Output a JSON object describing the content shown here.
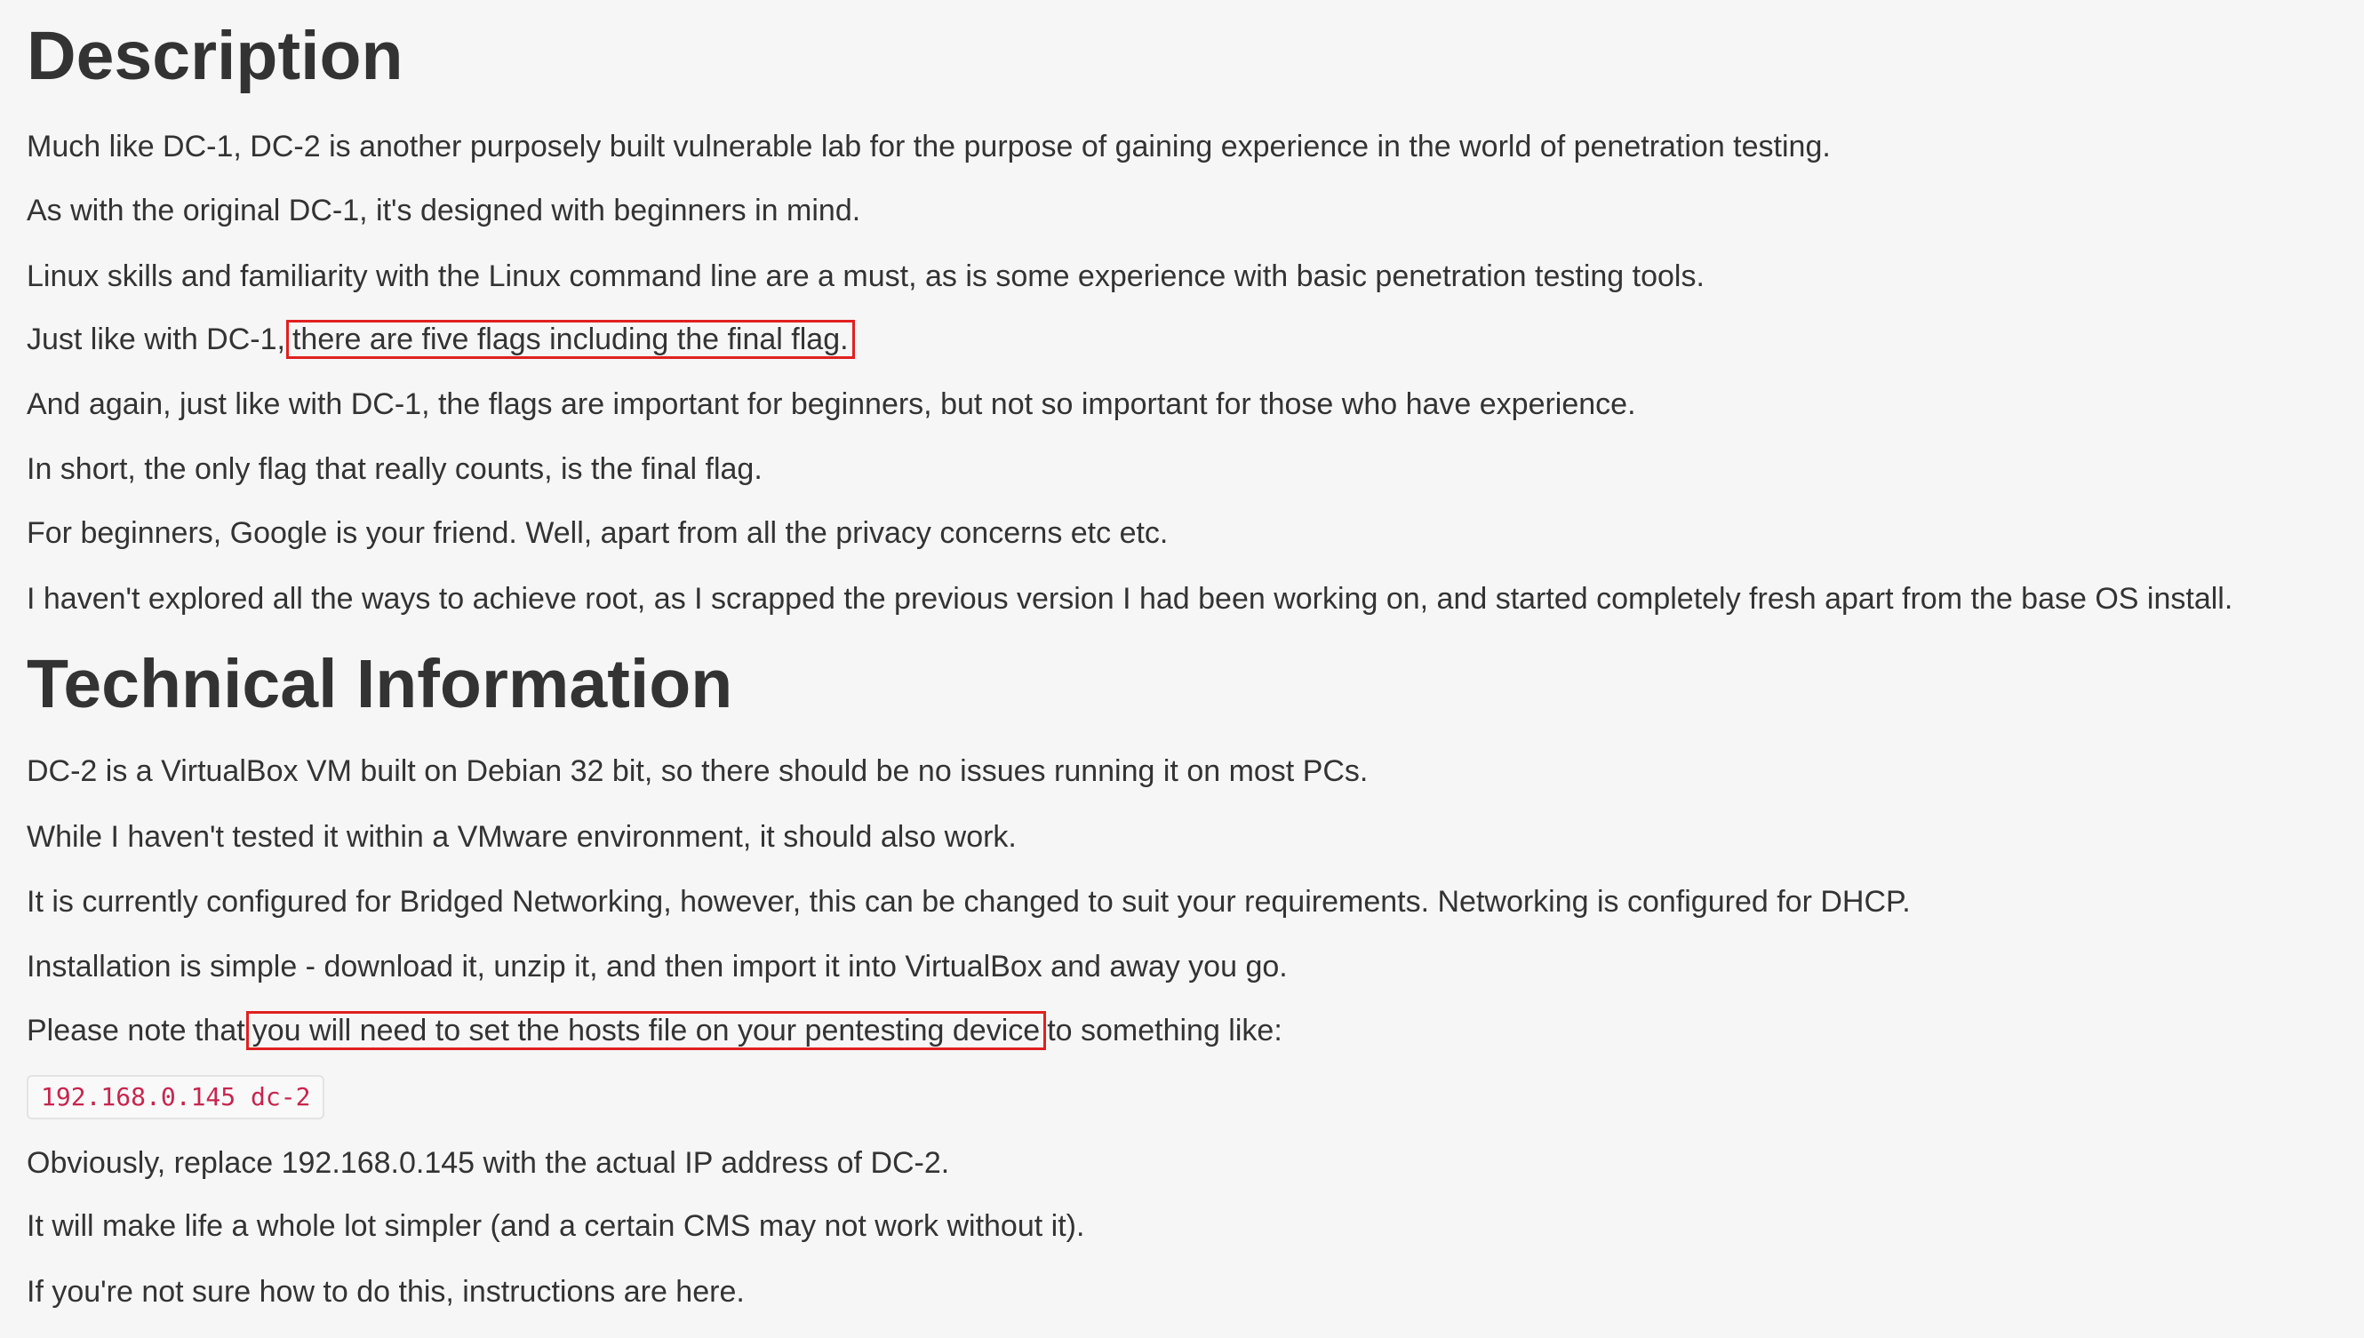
{
  "description": {
    "heading": "Description",
    "p1": "Much like DC-1, DC-2 is another purposely built vulnerable lab for the purpose of gaining experience in the world of penetration testing.",
    "p2": "As with the original DC-1, it's designed with beginners in mind.",
    "p3": "Linux skills and familiarity with the Linux command line are a must, as is some experience with basic penetration testing tools.",
    "p4_before": "Just like with DC-1,",
    "p4_highlight": "there are five flags including the final flag.",
    "p5": "And again, just like with DC-1, the flags are important for beginners, but not so important for those who have experience.",
    "p6": "In short, the only flag that really counts, is the final flag.",
    "p7": "For beginners, Google is your friend. Well, apart from all the privacy concerns etc etc.",
    "p8": "I haven't explored all the ways to achieve root, as I scrapped the previous version I had been working on, and started completely fresh apart from the base OS install."
  },
  "technical": {
    "heading": "Technical Information",
    "p1": "DC-2 is a VirtualBox VM built on Debian 32 bit, so there should be no issues running it on most PCs.",
    "p2": "While I haven't tested it within a VMware environment, it should also work.",
    "p3": "It is currently configured for Bridged Networking, however, this can be changed to suit your requirements. Networking is configured for DHCP.",
    "p4": "Installation is simple - download it, unzip it, and then import it into VirtualBox and away you go.",
    "p5_before": "Please note that",
    "p5_highlight": "you will need to set the hosts file on your pentesting device",
    "p5_after": "to something like:",
    "code": "192.168.0.145 dc-2",
    "p6": "Obviously, replace 192.168.0.145 with the actual IP address of DC-2.",
    "p7": "It will make life a whole lot simpler (and a certain CMS may not work without it).",
    "p8": "If you're not sure how to do this, instructions are here."
  },
  "colors": {
    "background": "#f6f6f6",
    "text": "#333333",
    "highlight_border": "#e02020",
    "code_text": "#c7254e"
  }
}
